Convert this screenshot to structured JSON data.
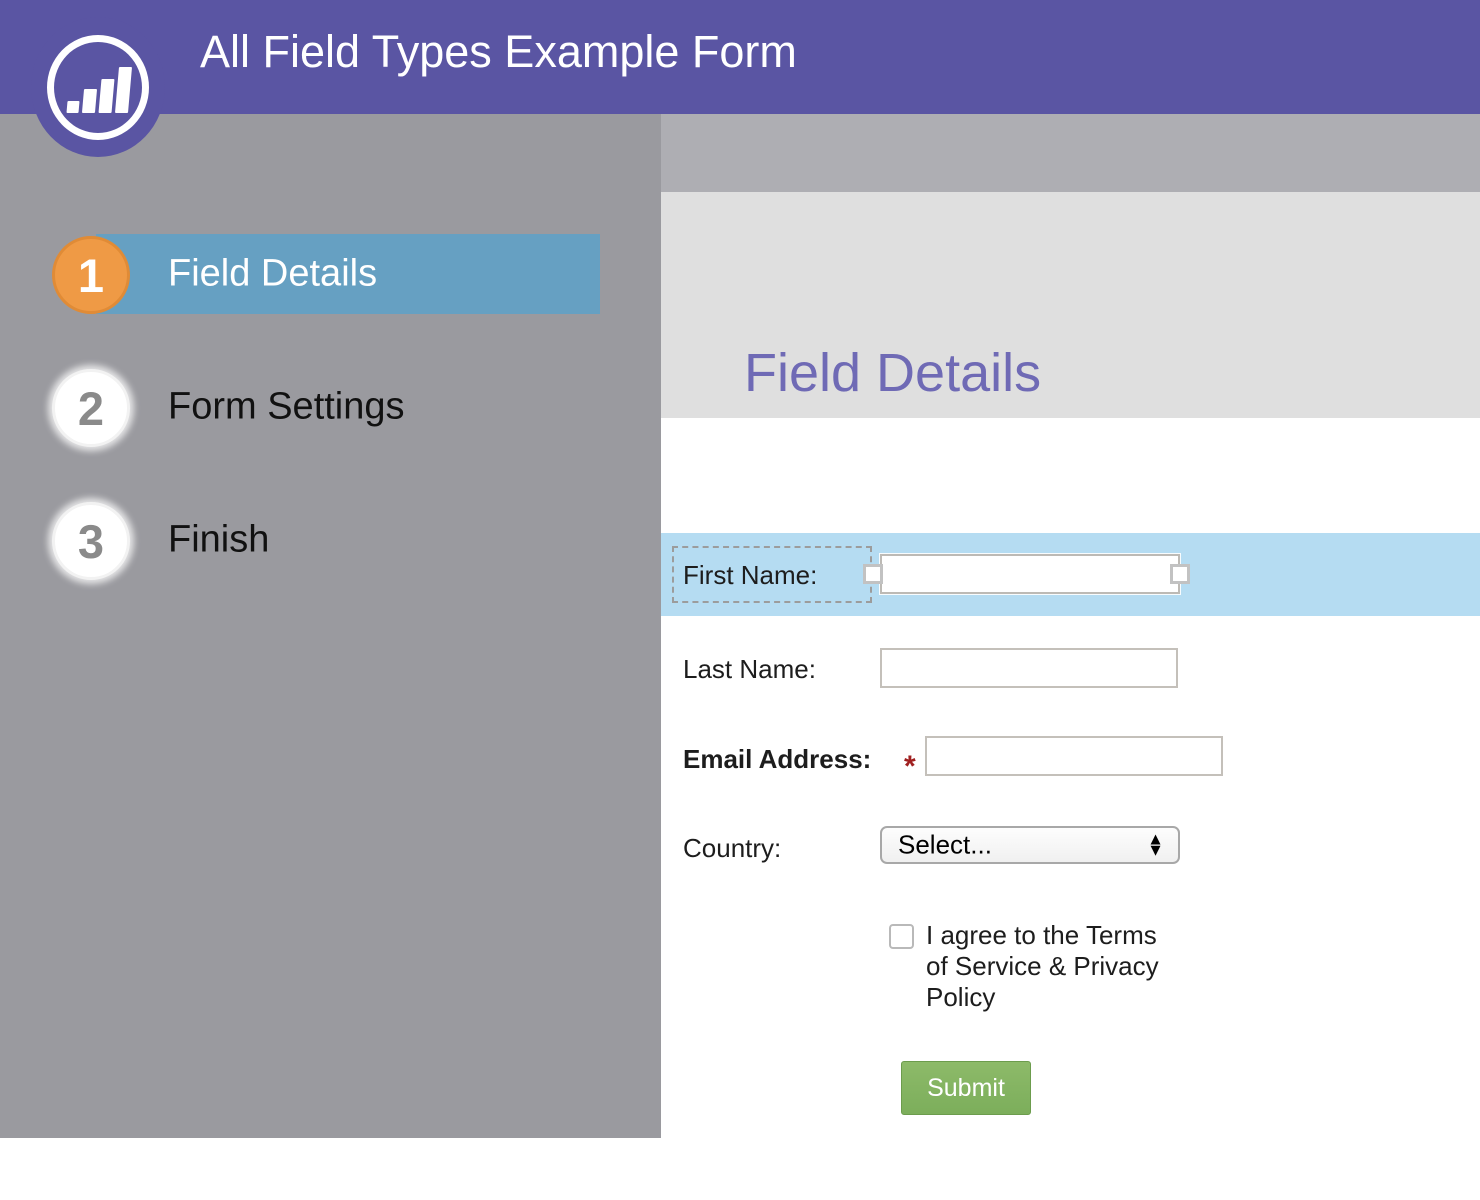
{
  "header": {
    "title": "All Field Types Example Form",
    "logo_icon": "bar-chart-circle-logo",
    "background_color": "#5a55a3"
  },
  "sidebar": {
    "background_color": "#9a9a9f",
    "active_highlight_color": "#66a0c2",
    "active_badge_color": "#ef9a45",
    "steps": [
      {
        "number": "1",
        "label": "Field Details",
        "active": true
      },
      {
        "number": "2",
        "label": "Form Settings",
        "active": false
      },
      {
        "number": "3",
        "label": "Finish",
        "active": false
      }
    ]
  },
  "main": {
    "page_title": "Field Details",
    "page_title_color": "#6f6ab5",
    "selected_row_color": "#b5dcf2",
    "fields": [
      {
        "name": "first_name",
        "label": "First Name:",
        "type": "text",
        "value": "",
        "required": false,
        "bold_label": false,
        "selected": true
      },
      {
        "name": "last_name",
        "label": "Last Name:",
        "type": "text",
        "value": "",
        "required": false,
        "bold_label": false,
        "selected": false
      },
      {
        "name": "email_address",
        "label": "Email Address:",
        "type": "text",
        "value": "",
        "required": true,
        "required_marker": "*",
        "bold_label": true,
        "selected": false
      },
      {
        "name": "country",
        "label": "Country:",
        "type": "select",
        "value": "Select...",
        "required": false,
        "bold_label": false,
        "selected": false
      }
    ],
    "consent": {
      "checked": false,
      "label": "I agree to the Terms of Service & Privacy Policy"
    },
    "submit": {
      "label": "Submit",
      "color": "#7cae5b"
    }
  }
}
